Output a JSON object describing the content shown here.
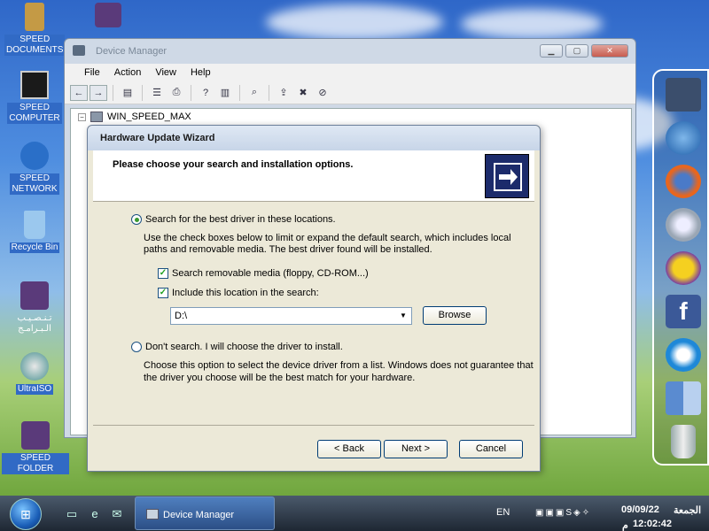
{
  "desktop": {
    "icons": [
      {
        "label": "SPEED\nDOCUMENTS",
        "icon": "speed-documents-icon",
        "color": "#8f6b2a"
      },
      {
        "label": "SPEED\nCOMPUTER",
        "icon": "speed-computer-icon",
        "color": "#222"
      },
      {
        "label": "SPEED\nNETWORK",
        "icon": "speed-network-icon",
        "color": "#2a6fc8"
      },
      {
        "label": "Recycle Bin",
        "icon": "recycle-bin-icon",
        "color": "#6ab0e8"
      },
      {
        "label": "تـنـصـيـب\nالـبـرامـج",
        "icon": "install-programs-icon",
        "color": "#5a3a7a"
      },
      {
        "label": "UltraISO",
        "icon": "ultraiso-icon",
        "color": "#c24020"
      },
      {
        "label": "SPEED FOLDER",
        "icon": "speed-folder-icon",
        "color": "#5a3a7a"
      }
    ]
  },
  "device_manager": {
    "title": "Device Manager",
    "menu": [
      "File",
      "Action",
      "View",
      "Help"
    ],
    "tree_root": "WIN_SPEED_MAX",
    "tree_expander": "−"
  },
  "wizard": {
    "title": "Hardware Update Wizard",
    "header": "Please choose your search and installation options.",
    "option1_label": "Search for the best driver in these locations.",
    "option1_desc_1": "Use the check boxes below to limit or expand the default search, which includes local",
    "option1_desc_2": "paths and removable media. The best driver found will be installed.",
    "checkbox1_label": "Search removable media (floppy, CD-ROM...)",
    "checkbox1_checked": true,
    "checkbox2_label": "Include this location in the search:",
    "checkbox2_checked": true,
    "location_value": "D:\\",
    "browse_label": "Browse",
    "option2_label": "Don't search. I will choose the driver to install.",
    "option2_desc_1": "Choose this option to select the device driver from a list.  Windows does not guarantee that",
    "option2_desc_2": "the driver you choose will be the best match for your hardware.",
    "selected_option": 1,
    "back_label": "< Back",
    "next_label": "Next >",
    "cancel_label": "Cancel"
  },
  "dock": {
    "items": [
      "computer-icon",
      "globe-icon",
      "firefox-icon",
      "settings-gear-icon",
      "yahoo-messenger-icon",
      "facebook-icon",
      "internet-explorer-icon",
      "finder-icon",
      "trash-icon"
    ],
    "colors": [
      "#3b4e6c",
      "#2b70c9",
      "#e8661e",
      "#9aa6b4",
      "#7b3fa0",
      "#3b5998",
      "#1e88d8",
      "#6a9ad8",
      "#c8ccd0"
    ]
  },
  "taskbar": {
    "task_label": "Device Manager",
    "language": "EN",
    "date": "09/09/22",
    "day": "الجمعة",
    "time": "12:02:42",
    "ampm": "م"
  }
}
